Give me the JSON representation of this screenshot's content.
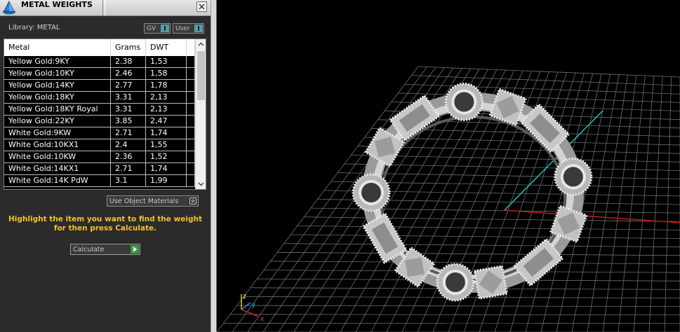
{
  "window": {
    "title": "METAL WEIGHTS"
  },
  "library": {
    "label": "Library: METAL",
    "gv_label": "GV",
    "user_label": "User"
  },
  "table": {
    "headers": {
      "metal": "Metal",
      "grams": "Grams",
      "dwt": "DWT"
    },
    "rows": [
      {
        "metal": "Yellow Gold:9KY",
        "grams": "2.38",
        "dwt": "1,53"
      },
      {
        "metal": "Yellow Gold:10KY",
        "grams": "2.46",
        "dwt": "1,58"
      },
      {
        "metal": "Yellow Gold:14KY",
        "grams": "2.77",
        "dwt": "1,78"
      },
      {
        "metal": "Yellow Gold:18KY",
        "grams": "3.31",
        "dwt": "2,13"
      },
      {
        "metal": "Yellow Gold:18KY Royal",
        "grams": "3.31",
        "dwt": "2,13"
      },
      {
        "metal": "Yellow Gold:22KY",
        "grams": "3.85",
        "dwt": "2,47"
      },
      {
        "metal": "White Gold:9KW",
        "grams": "2.71",
        "dwt": "1,74"
      },
      {
        "metal": "White Gold:10KX1",
        "grams": "2.4",
        "dwt": "1,55"
      },
      {
        "metal": "White Gold:10KW",
        "grams": "2.36",
        "dwt": "1,52"
      },
      {
        "metal": "White Gold:14KX1",
        "grams": "2.71",
        "dwt": "1,74"
      },
      {
        "metal": "White Gold:14K PdW",
        "grams": "3.1",
        "dwt": "1,99"
      }
    ]
  },
  "use_object_materials": "Use Object Materials",
  "instruction": "Highlight the item you want to find the weight for then press Calculate.",
  "calculate_label": "Calculate",
  "viewport": {
    "axis_x": "x",
    "axis_y": "y",
    "axis_z": "z",
    "colors": {
      "grid": "#6e6e6e",
      "axis_red": "#c01818",
      "axis_cyan": "#2ab3bf",
      "background": "#000000"
    }
  }
}
